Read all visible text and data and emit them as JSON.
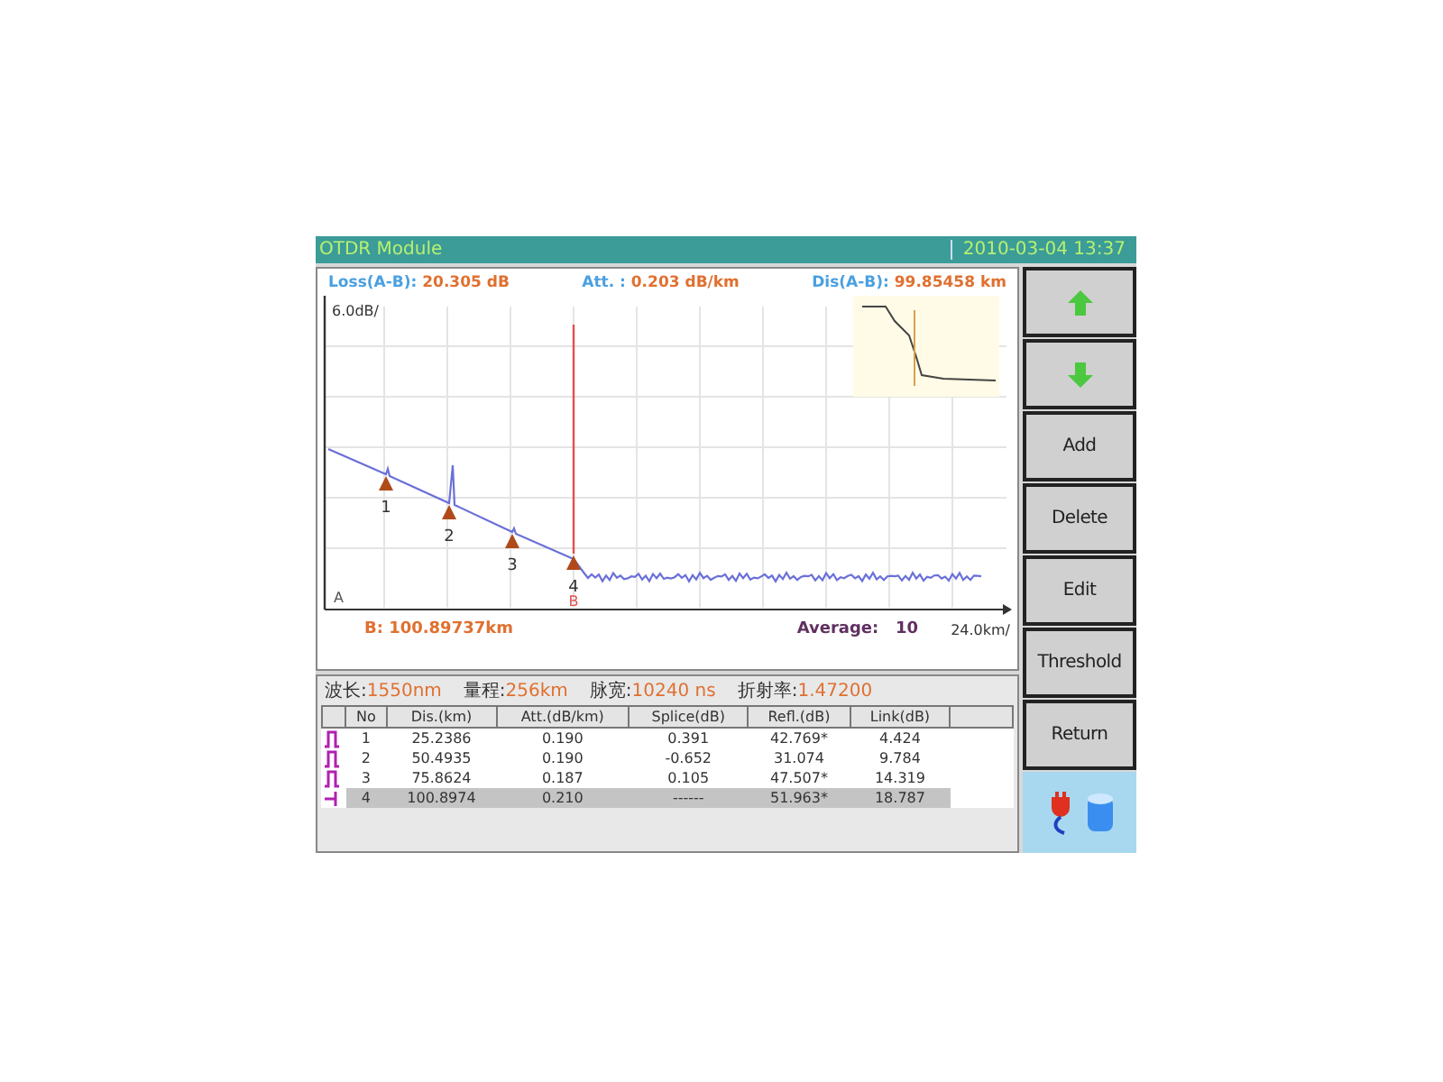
{
  "window": {
    "title": "OTDR Module",
    "datetime": "2010-03-04  13:37"
  },
  "readouts": [
    {
      "label": "Loss(A-B):",
      "value": "20.305 dB"
    },
    {
      "label": "Att.  :",
      "value": "0.203 dB/km"
    },
    {
      "label": "Dis(A-B):",
      "value": "99.85458 km"
    }
  ],
  "graph": {
    "y_scale": "6.0dB/",
    "x_scale": "24.0km/",
    "cursor_a": "A",
    "cursor_b": "B",
    "events": [
      {
        "label": "1"
      },
      {
        "label": "2"
      },
      {
        "label": "3"
      },
      {
        "label": "4"
      }
    ]
  },
  "cursor_b_position": "B: 100.89737km",
  "average": {
    "label": "Average:",
    "value": "10"
  },
  "parameters": [
    {
      "label": "波长:",
      "value": "1550nm"
    },
    {
      "label": "量程:",
      "value": "256km"
    },
    {
      "label": "脉宽:",
      "value": "10240 ns"
    },
    {
      "label": "折射率:",
      "value": "1.47200"
    }
  ],
  "table": {
    "columns": [
      "No",
      "Dis.(km)",
      "Att.(dB/km)",
      "Splice(dB)",
      "Refl.(dB)",
      "Link(dB)"
    ],
    "rows": [
      {
        "kind": "reflective",
        "selected": false,
        "cells": [
          "1",
          "25.2386",
          "0.190",
          "0.391",
          "42.769*",
          "4.424"
        ]
      },
      {
        "kind": "reflective",
        "selected": false,
        "cells": [
          "2",
          "50.4935",
          "0.190",
          "-0.652",
          "31.074",
          "9.784"
        ]
      },
      {
        "kind": "reflective",
        "selected": false,
        "cells": [
          "3",
          "75.8624",
          "0.187",
          "0.105",
          "47.507*",
          "14.319"
        ]
      },
      {
        "kind": "end",
        "selected": true,
        "cells": [
          "4",
          "100.8974",
          "0.210",
          "------",
          "51.963*",
          "18.787"
        ]
      }
    ]
  },
  "buttons": [
    {
      "kind": "up"
    },
    {
      "kind": "down"
    },
    {
      "kind": "text",
      "label": "Add"
    },
    {
      "kind": "text",
      "label": "Delete"
    },
    {
      "kind": "text",
      "label": "Edit"
    },
    {
      "kind": "text",
      "label": "Threshold"
    },
    {
      "kind": "text",
      "label": "Return"
    }
  ]
}
